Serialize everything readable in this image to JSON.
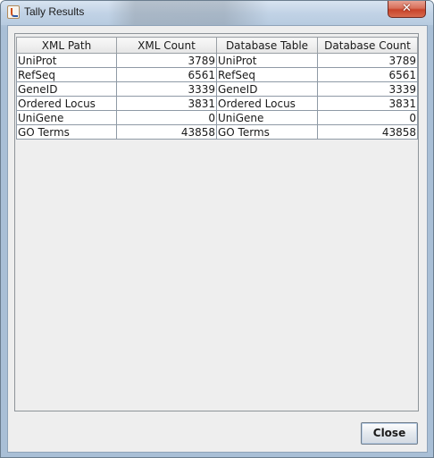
{
  "window": {
    "title": "Tally Results",
    "close_glyph": "✕"
  },
  "table": {
    "headers": [
      "XML Path",
      "XML Count",
      "Database Table",
      "Database Count"
    ],
    "rows": [
      [
        "UniProt",
        "3789",
        "UniProt",
        "3789"
      ],
      [
        "RefSeq",
        "6561",
        "RefSeq",
        "6561"
      ],
      [
        "GeneID",
        "3339",
        "GeneID",
        "3339"
      ],
      [
        "Ordered Locus",
        "3831",
        "Ordered Locus",
        "3831"
      ],
      [
        "UniGene",
        "0",
        "UniGene",
        "0"
      ],
      [
        "GO Terms",
        "43858",
        "GO Terms",
        "43858"
      ]
    ]
  },
  "footer": {
    "close_label": "Close"
  },
  "icons": {
    "app_icon": "java-app-icon",
    "window_close": "close-icon"
  }
}
